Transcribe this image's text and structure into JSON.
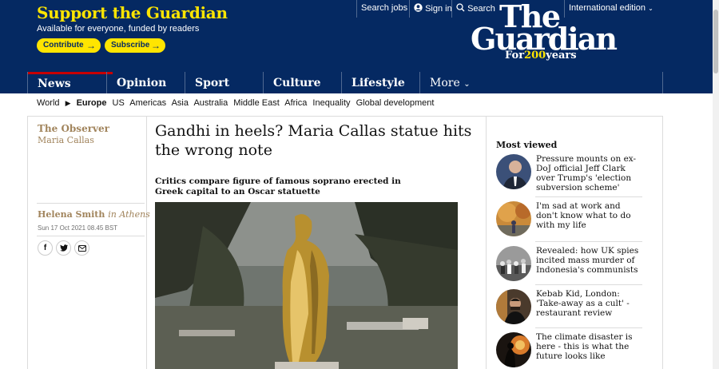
{
  "support": {
    "title": "Support the Guardian",
    "subtitle": "Available for everyone, funded by readers",
    "contribute_label": "Contribute",
    "subscribe_label": "Subscribe"
  },
  "top_links": {
    "search_jobs": "Search jobs",
    "sign_in": "Sign in",
    "search": "Search",
    "edition": "International edition"
  },
  "logo": {
    "line1": "The",
    "line2": "Guardian",
    "tagline_prefix": "For",
    "tagline_number": "200",
    "tagline_suffix": "years"
  },
  "nav": [
    {
      "label": "News",
      "active": true
    },
    {
      "label": "Opinion",
      "active": false
    },
    {
      "label": "Sport",
      "active": false
    },
    {
      "label": "Culture",
      "active": false
    },
    {
      "label": "Lifestyle",
      "active": false
    },
    {
      "label": "More",
      "active": false
    }
  ],
  "subnav": [
    "World",
    "Europe",
    "US",
    "Americas",
    "Asia",
    "Australia",
    "Middle East",
    "Africa",
    "Inequality",
    "Global development"
  ],
  "article": {
    "section": "The Observer",
    "series": "Maria Callas",
    "author": "Helena Smith",
    "location": "in Athens",
    "date": "Sun 17 Oct 2021 08.45 BST",
    "headline": "Gandhi in heels? Maria Callas statue hits the wrong note",
    "standfirst": "Critics compare figure of famous soprano erected in Greek capital to an Oscar statuette"
  },
  "most_viewed": {
    "title": "Most viewed",
    "items": [
      "Pressure mounts on ex-DoJ official Jeff Clark over Trump's 'election subversion scheme'",
      "I'm sad at work and don't know what to do with my life",
      "Revealed: how UK spies incited mass murder of Indonesia's communists",
      "Kebab Kid, London: 'Take-away as a cult' - restaurant review",
      "The climate disaster is here - this is what the future looks like"
    ]
  },
  "colors": {
    "brand_blue": "#052962",
    "accent_yellow": "#ffe500",
    "news_red": "#c70000",
    "observer_gold": "#a1845c"
  }
}
